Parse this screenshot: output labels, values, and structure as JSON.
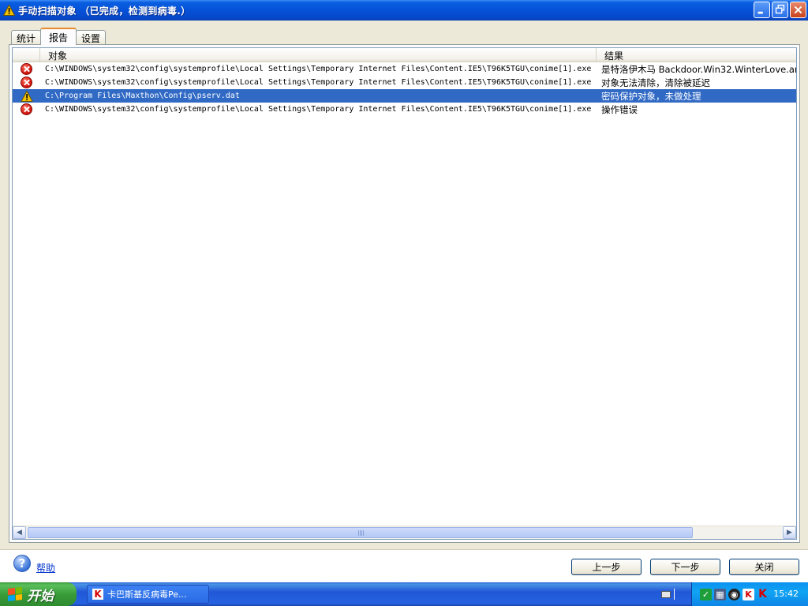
{
  "window": {
    "title": "手动扫描对象 （已完成，检测到病毒.）"
  },
  "tabs": [
    {
      "label": "统计",
      "active": false
    },
    {
      "label": "报告",
      "active": true
    },
    {
      "label": "设置",
      "active": false
    }
  ],
  "table": {
    "columns": [
      "对象",
      "结果"
    ],
    "rows": [
      {
        "status": "error",
        "object": "C:\\WINDOWS\\system32\\config\\systemprofile\\Local Settings\\Temporary Internet Files\\Content.IE5\\T96K5TGU\\conime[1].exe",
        "result": "是特洛伊木马 Backdoor.Win32.WinterLove.ar"
      },
      {
        "status": "error",
        "object": "C:\\WINDOWS\\system32\\config\\systemprofile\\Local Settings\\Temporary Internet Files\\Content.IE5\\T96K5TGU\\conime[1].exe",
        "result": "对象无法清除，清除被延迟"
      },
      {
        "status": "warning",
        "object": "C:\\Program Files\\Maxthon\\Config\\pserv.dat",
        "result": "密码保护对象，未做处理",
        "selected": true
      },
      {
        "status": "error",
        "object": "C:\\WINDOWS\\system32\\config\\systemprofile\\Local Settings\\Temporary Internet Files\\Content.IE5\\T96K5TGU\\conime[1].exe",
        "result": "操作错误"
      }
    ]
  },
  "footer": {
    "help_label": "帮助",
    "prev_label": "上一步",
    "next_label": "下一步",
    "close_label": "关闭"
  },
  "taskbar": {
    "start_label": "开始",
    "task_label": "卡巴斯基反病毒Pe...",
    "clock": "15:42"
  },
  "colors": {
    "selection": "#316ac5",
    "title_blue": "#0652d8",
    "start_green": "#389c38",
    "error_red": "#d4170f",
    "warning_yellow": "#f2c200"
  }
}
